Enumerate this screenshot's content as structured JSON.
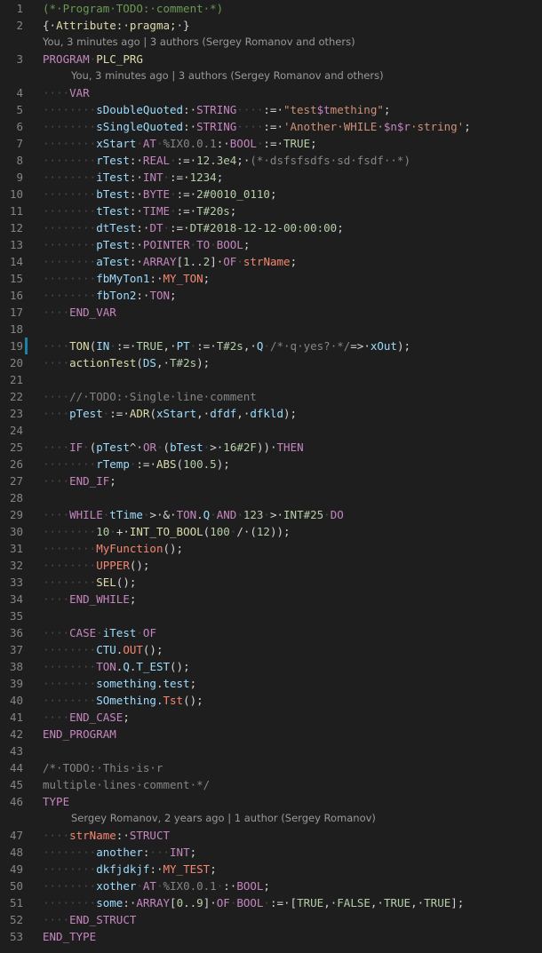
{
  "editor": {
    "blame": [
      "You, 3 minutes ago | 3 authors (Sergey Romanov and others)",
      "You, 3 minutes ago | 3 authors (Sergey Romanov and others)",
      "Sergey Romanov, 2 years ago | 1 author (Sergey Romanov)"
    ]
  }
}
